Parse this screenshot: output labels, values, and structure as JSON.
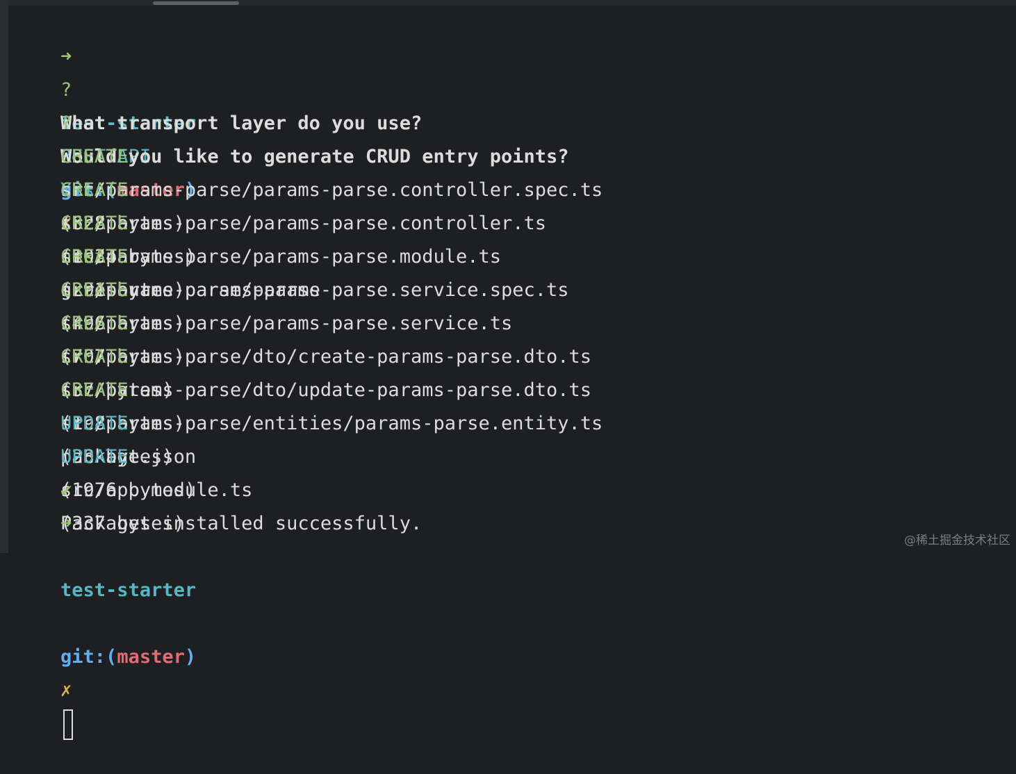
{
  "colors": {
    "background": "#1e1f22",
    "text": "#dcdcdc",
    "prompt_arrow": "#98c379",
    "prompt_dir": "#56b6c2",
    "git_label": "#61afef",
    "branch": "#e06c75",
    "dirty_mark": "#d7b84e",
    "create": "#98c379",
    "update": "#56b6c2"
  },
  "prompt": {
    "arrow_icon": "➜",
    "directory": "test-starter",
    "git_label": "git:(",
    "branch": "master",
    "git_close": ")",
    "dirty_mark": "✗"
  },
  "command": {
    "program": "nest",
    "args": "g resource params-parse"
  },
  "questions": [
    {
      "marker": "?",
      "text": "What transport layer do you use?",
      "answer": "REST API"
    },
    {
      "marker": "?",
      "text": "Would you like to generate CRUD entry points?",
      "answer": "Yes"
    }
  ],
  "file_ops": [
    {
      "action": "CREATE",
      "path": "src/params-parse/params-parse.controller.spec.ts",
      "size": "(628 bytes)"
    },
    {
      "action": "CREATE",
      "path": "src/params-parse/params-parse.controller.ts",
      "size": "(1034 bytes)"
    },
    {
      "action": "CREATE",
      "path": "src/params-parse/params-parse.module.ts",
      "size": "(291 bytes)"
    },
    {
      "action": "CREATE",
      "path": "src/params-parse/params-parse.service.spec.ts",
      "size": "(496 bytes)"
    },
    {
      "action": "CREATE",
      "path": "src/params-parse/params-parse.service.ts",
      "size": "(707 bytes)"
    },
    {
      "action": "CREATE",
      "path": "src/params-parse/dto/create-params-parse.dto.ts",
      "size": "(37 bytes)"
    },
    {
      "action": "CREATE",
      "path": "src/params-parse/dto/update-params-parse.dto.ts",
      "size": "(198 bytes)"
    },
    {
      "action": "CREATE",
      "path": "src/params-parse/entities/params-parse.entity.ts",
      "size": "(28 bytes)"
    },
    {
      "action": "UPDATE",
      "path": "package.json",
      "size": "(1976 bytes)"
    },
    {
      "action": "UPDATE",
      "path": "src/app.module.ts",
      "size": "(337 bytes)"
    }
  ],
  "success": {
    "icon": "✔",
    "text": "Packages installed successfully."
  },
  "watermark": "@稀土掘金技术社区"
}
